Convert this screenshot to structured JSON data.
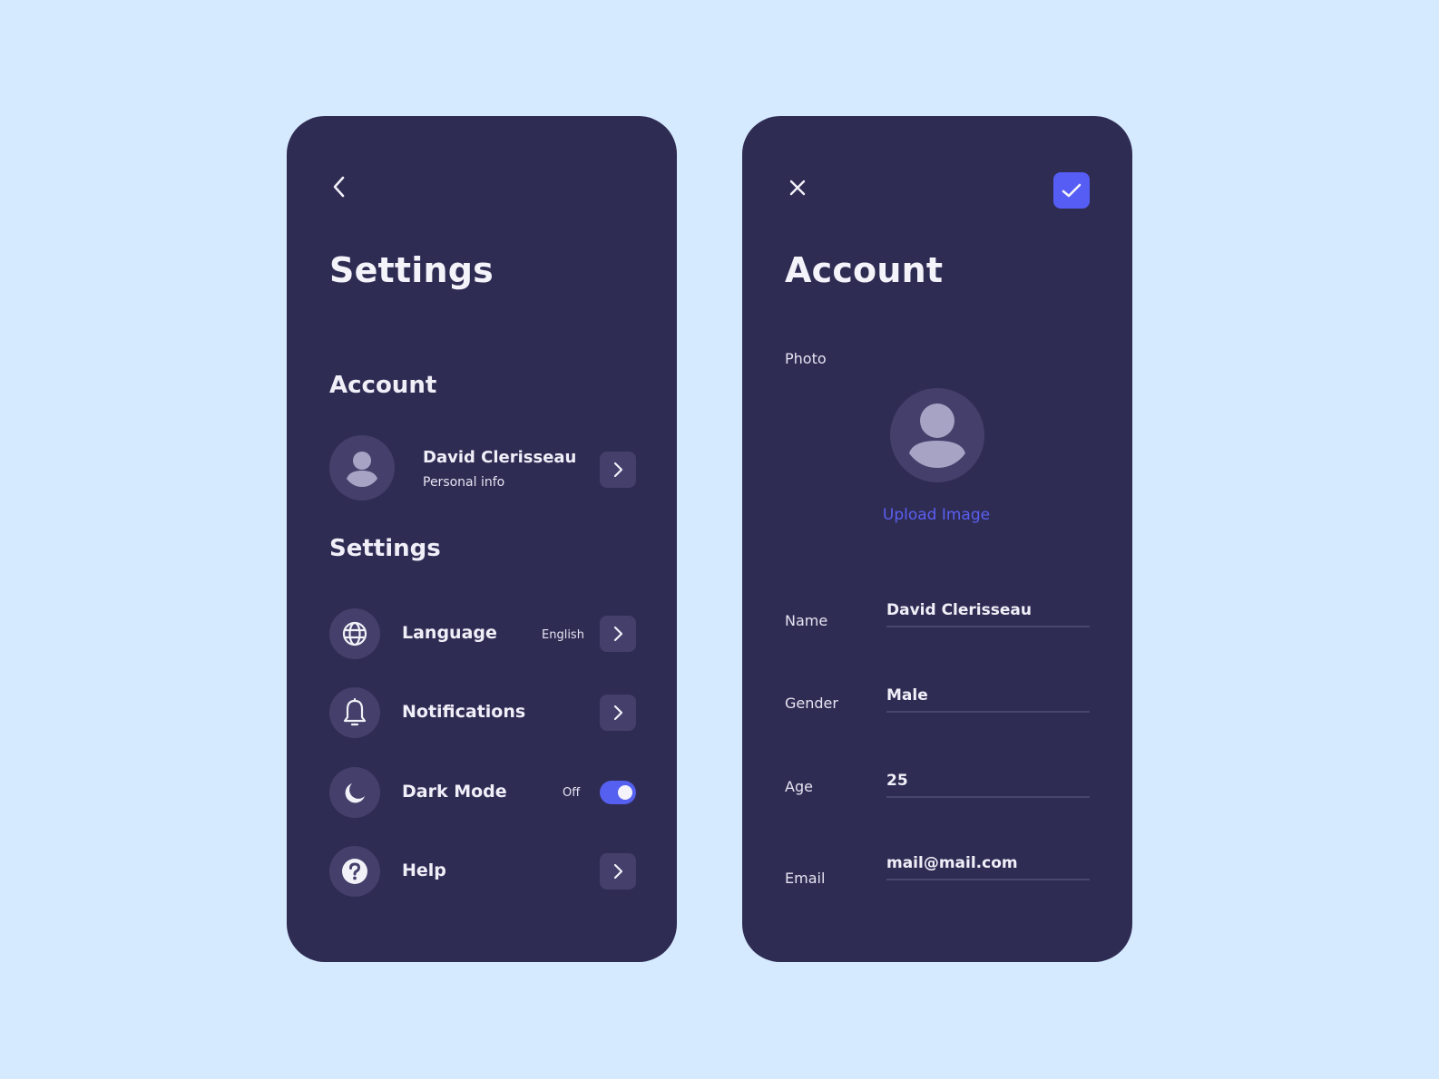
{
  "settings_screen": {
    "title": "Settings",
    "back_icon": "chevron-left-icon",
    "account_section": {
      "title": "Account",
      "profile": {
        "name": "David Clerisseau",
        "subtitle": "Personal info",
        "avatar_icon": "user-icon",
        "action_icon": "chevron-right-icon"
      }
    },
    "settings_section": {
      "title": "Settings",
      "items": [
        {
          "label": "Language",
          "icon": "globe-icon",
          "value": "English",
          "control": "chevron"
        },
        {
          "label": "Notifications",
          "icon": "bell-icon",
          "value": "",
          "control": "chevron"
        },
        {
          "label": "Dark Mode",
          "icon": "moon-icon",
          "value": "Off",
          "control": "toggle",
          "toggle_on": true
        },
        {
          "label": "Help",
          "icon": "help-circle-icon",
          "value": "",
          "control": "chevron"
        }
      ]
    }
  },
  "account_screen": {
    "title": "Account",
    "close_icon": "close-icon",
    "save_icon": "check-icon",
    "photo_label": "Photo",
    "upload_label": "Upload Image",
    "fields": [
      {
        "label": "Name",
        "value": "David Clerisseau"
      },
      {
        "label": "Gender",
        "value": "Male"
      },
      {
        "label": "Age",
        "value": "25"
      },
      {
        "label": "Email",
        "value": "mail@mail.com"
      }
    ]
  },
  "colors": {
    "page_background": "#d6eaff",
    "card_background": "#2f2c54",
    "icon_chip": "#443f6b",
    "accent": "#565df4",
    "link": "#5a5ff0",
    "text": "#f2f1f8"
  }
}
